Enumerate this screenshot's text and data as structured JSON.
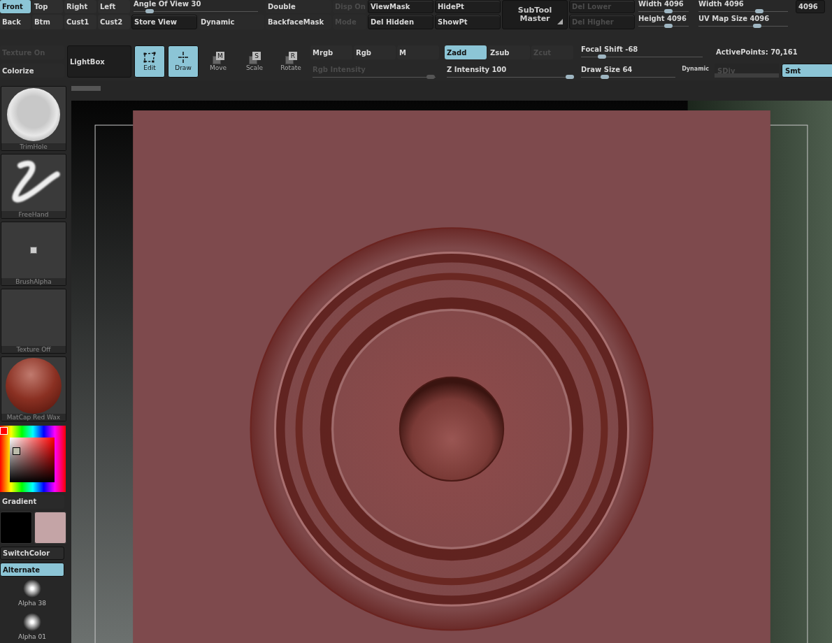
{
  "view_grid": [
    {
      "kind": "button",
      "label": "Front",
      "selected": true,
      "disabled": false
    },
    {
      "kind": "button",
      "label": "Top",
      "selected": false,
      "disabled": false
    },
    {
      "kind": "button",
      "label": "Right",
      "selected": false,
      "disabled": false
    },
    {
      "kind": "button",
      "label": "Left",
      "selected": false,
      "disabled": false
    },
    {
      "kind": "wideslider",
      "label": "Angle Of View 30",
      "level": 0.13,
      "disabled": false
    },
    {
      "kind": "label",
      "label": "Double",
      "selected": false,
      "disabled": false
    },
    {
      "kind": "label",
      "label": "Disp On",
      "selected": false,
      "disabled": true
    },
    {
      "kind": "boxed",
      "label": "ViewMask",
      "selected": false,
      "disabled": false
    },
    {
      "kind": "boxed",
      "label": "HidePt",
      "selected": false,
      "disabled": false
    },
    {
      "kind": "button",
      "label": "Back",
      "selected": false,
      "disabled": false
    },
    {
      "kind": "button",
      "label": "Btm",
      "selected": false,
      "disabled": false
    },
    {
      "kind": "button",
      "label": "Cust1",
      "selected": false,
      "disabled": false
    },
    {
      "kind": "button",
      "label": "Cust2",
      "selected": false,
      "disabled": false
    },
    {
      "kind": "boxed",
      "label": "Store View",
      "selected": false,
      "disabled": false
    },
    {
      "kind": "label",
      "label": "Dynamic",
      "selected": false,
      "disabled": false
    },
    {
      "kind": "label",
      "label": "BackfaceMask",
      "selected": false,
      "disabled": false
    },
    {
      "kind": "label",
      "label": "Mode",
      "selected": false,
      "disabled": true
    },
    {
      "kind": "boxed",
      "label": "Del Hidden",
      "selected": false,
      "disabled": false
    },
    {
      "kind": "boxed",
      "label": "ShowPt",
      "selected": false,
      "disabled": false
    }
  ],
  "subtool": {
    "label": "SubTool Master"
  },
  "size_grid": [
    {
      "kind": "boxed",
      "label": "Del Lower",
      "selected": false,
      "disabled": true
    },
    {
      "kind": "slider",
      "label": "Width 4096",
      "level": 0.6,
      "disabled": false
    },
    {
      "kind": "slider",
      "label": "Width 4096",
      "level": 0.68,
      "disabled": false
    },
    {
      "kind": "readout",
      "label": "4096",
      "selected": false,
      "disabled": false
    },
    {
      "kind": "boxed",
      "label": "Del Higher",
      "selected": false,
      "disabled": true
    },
    {
      "kind": "slider",
      "label": "Height 4096",
      "level": 0.6,
      "disabled": false
    },
    {
      "kind": "slider",
      "label": "UV Map Size 4096",
      "level": 0.66,
      "disabled": false
    }
  ],
  "tool_bar": {
    "side_buttons": [
      {
        "label": "Texture On",
        "disabled": true
      },
      {
        "label": "Colorize",
        "disabled": false
      }
    ],
    "lightbox": {
      "label": "LightBox"
    },
    "modes": [
      {
        "kind": "edit",
        "label": "Edit",
        "selected": true
      },
      {
        "kind": "draw",
        "label": "Draw",
        "selected": true
      }
    ],
    "transforms": [
      {
        "label": "Move",
        "key": "M",
        "selected": false
      },
      {
        "label": "Scale",
        "key": "S",
        "selected": false
      },
      {
        "label": "Rotate",
        "key": "R",
        "selected": false
      }
    ],
    "channel_groups": [
      {
        "buttons": [
          {
            "label": "Mrgb",
            "selected": false,
            "disabled": false
          },
          {
            "label": "Rgb",
            "selected": false,
            "disabled": false
          },
          {
            "label": "M",
            "selected": false,
            "disabled": false
          }
        ],
        "slider": {
          "label": "Rgb Intensity",
          "level": 0.96,
          "disabled": true
        }
      },
      {
        "buttons": [
          {
            "label": "Zadd",
            "selected": true,
            "disabled": false
          },
          {
            "label": "Zsub",
            "selected": false,
            "disabled": false
          },
          {
            "label": "Zcut",
            "selected": false,
            "disabled": true
          }
        ],
        "slider": {
          "label": "Z Intensity 100",
          "level": 1,
          "disabled": false
        }
      }
    ],
    "brush_sliders": [
      {
        "label": "Focal Shift -68",
        "level": 0.17,
        "disabled": false
      },
      {
        "label": "Draw Size 64",
        "level": 0.25,
        "disabled": false
      }
    ],
    "dynamic": "Dynamic",
    "active_points": "ActivePoints: 70,161",
    "sdiv": {
      "label": "SDiv",
      "disabled": true
    },
    "smt": {
      "label": "Smt",
      "selected": true
    }
  },
  "side_panel": {
    "thumbnails": [
      {
        "kind": "sphere",
        "label": "TrimHole"
      },
      {
        "kind": "stroke",
        "label": "FreeHand"
      },
      {
        "kind": "alpha",
        "label": "BrushAlpha"
      },
      {
        "kind": "empty",
        "label": "Texture Off"
      },
      {
        "kind": "matcap",
        "label": "MatCap Red Wax"
      }
    ],
    "gradient": "Gradient",
    "swatches": [
      {
        "color": "#000000"
      },
      {
        "color": "#c4a4a6"
      }
    ],
    "buttons": [
      {
        "label": "SwitchColor",
        "selected": false
      },
      {
        "label": "Alternate",
        "selected": true
      }
    ],
    "alphas": [
      {
        "label": "Alpha 38"
      },
      {
        "label": "Alpha 01"
      }
    ]
  }
}
